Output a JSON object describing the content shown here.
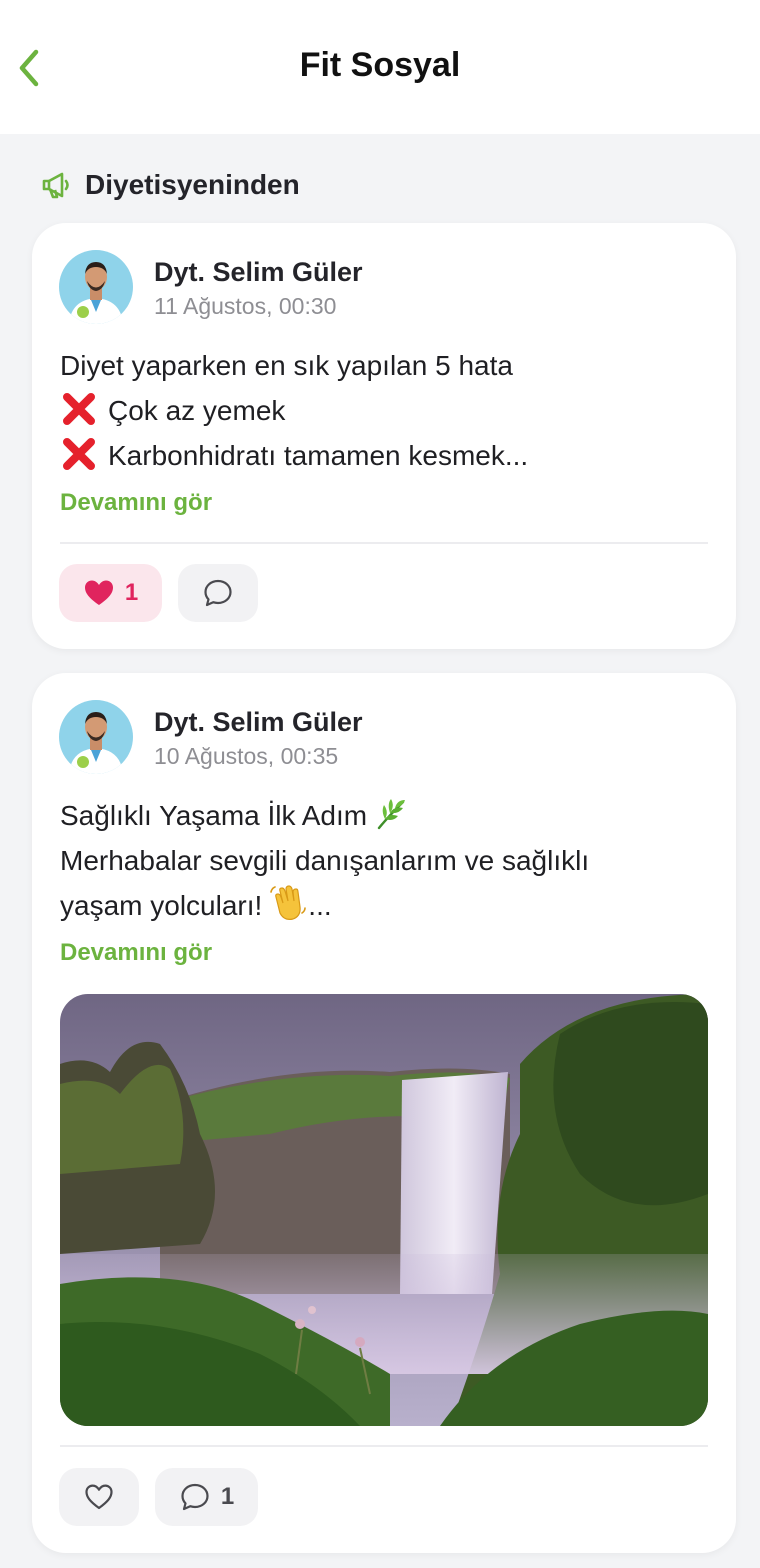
{
  "header": {
    "title": "Fit Sosyal",
    "back_icon": "chevron-left-icon",
    "accent_color": "#6cb33f"
  },
  "section": {
    "title": "Diyetisyeninden",
    "icon": "megaphone-icon"
  },
  "posts": [
    {
      "author": "Dyt. Selim Güler",
      "date": "11 Ağustos, 00:30",
      "lines": [
        "Diyet yaparken en sık yapılan 5 hata",
        "Çok az yemek",
        "Karbonhidratı tamamen kesmek..."
      ],
      "see_more": "Devamını gör",
      "likes": "1",
      "liked": true
    },
    {
      "author": "Dyt. Selim Güler",
      "date": "10 Ağustos, 00:35",
      "lines": [
        "Sağlıklı Yaşama İlk Adım",
        "Merhabalar sevgili danışanlarım ve sağlıklı",
        "yaşam yolcuları!",
        "..."
      ],
      "see_more": "Devamını gör",
      "comments": "1",
      "liked": false,
      "image": "waterfall-landscape"
    }
  ]
}
